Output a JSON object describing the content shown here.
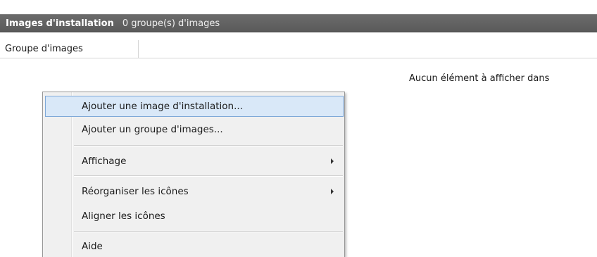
{
  "header": {
    "title": "Images d'installation",
    "count": "0 groupe(s) d'images"
  },
  "columns": {
    "group": "Groupe d'images"
  },
  "empty_message": "Aucun élément à afficher dans",
  "context_menu": {
    "items": [
      {
        "label": "Ajouter une image d'installation...",
        "submenu": false,
        "highlighted": true
      },
      {
        "label": "Ajouter un groupe d'images...",
        "submenu": false
      },
      {
        "label": "Affichage",
        "submenu": true
      },
      {
        "label": "Réorganiser les icônes",
        "submenu": true
      },
      {
        "label": "Aligner les icônes",
        "submenu": false
      },
      {
        "label": "Aide",
        "submenu": false
      }
    ]
  }
}
